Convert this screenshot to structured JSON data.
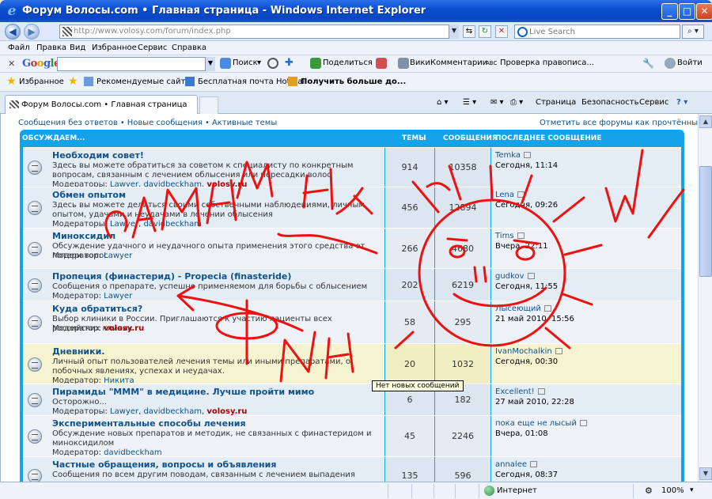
{
  "window": {
    "title": "Форум Волосы.com • Главная страница - Windows Internet Explorer",
    "minimize": "_",
    "maximize": "□",
    "close": "✕"
  },
  "address": {
    "url": "http://www.volosy.com/forum/index.php",
    "search_placeholder": "Live Search"
  },
  "menu": [
    "Файл",
    "Правка",
    "Вид",
    "Избранное",
    "Сервис",
    "Справка"
  ],
  "google_toolbar": {
    "logo": "Google",
    "search_btn": "Поиск",
    "share": "Поделиться",
    "wiki": "ВикиКомментарии",
    "spell": "Проверка правописа...",
    "login": "Войти"
  },
  "favorites": {
    "label": "Избранное",
    "items": [
      "Рекомендуемые сайты",
      "Бесплатная почта Hotmail",
      "Получить больше до..."
    ]
  },
  "tabs": {
    "active": "Форум Волосы.com • Главная страница",
    "commands": [
      "Страница",
      "Безопасность",
      "Сервис"
    ]
  },
  "page": {
    "links": [
      "Сообщения без ответов",
      "Новые сообщения",
      "Активные темы"
    ],
    "link_sep": "•",
    "mark_read": "Отметить все форумы как прочтённые",
    "header": {
      "category": "ОБСУЖДАЕМ...",
      "topics": "ТЕМЫ",
      "posts": "СООБЩЕНИЯ",
      "last": "ПОСЛЕДНЕЕ СООБЩЕНИЕ"
    },
    "forums": [
      {
        "title": "Необходим совет!",
        "desc": "Здесь вы можете обратиться за советом к специалисту по конкретным вопросам, связанным с лечением облысения или пересадки волос",
        "mod_label": "Модераторы:",
        "mods": [
          "Lawyer",
          "davidbeckham"
        ],
        "mods_red": [
          "volosy.ru"
        ],
        "topics": "914",
        "posts": "10358",
        "last_user": "Temka",
        "last_date": "Сегодня, 11:14"
      },
      {
        "title": "Обмен опытом",
        "desc": "Здесь вы можете делиться своими собственными наблюдениями, личным опытом, удачами и неудачами в лечении облысения",
        "mod_label": "Модераторы:",
        "mods": [
          "Lawyer",
          "davidbeckham"
        ],
        "mods_red": [],
        "topics": "456",
        "posts": "12894",
        "last_user": "Lena",
        "last_date": "Сегодня, 09:26"
      },
      {
        "title": "Миноксидил",
        "desc": "Обсуждение удачного и неудачного опыта применения этого средства от потери волос",
        "mod_label": "Модератор:",
        "mods": [
          "Lawyer"
        ],
        "mods_red": [],
        "topics": "266",
        "posts": "4680",
        "last_user": "Tims",
        "last_date": "Вчера, 22:11"
      },
      {
        "title": "Пропеция (финастерид) - Propecia (finasteride)",
        "desc": "Сообщения о препарате, успешно применяемом для борьбы с облысением",
        "mod_label": "Модератор:",
        "mods": [
          "Lawyer"
        ],
        "mods_red": [],
        "topics": "202",
        "posts": "6219",
        "last_user": "gudkov",
        "last_date": "Сегодня, 11:55"
      },
      {
        "title": "Куда обратиться?",
        "desc": "Выбор клиники в России. Приглашаются к участию пациенты всех российских клиник",
        "mod_label": "Модератор:",
        "mods": [],
        "mods_red": [
          "volosy.ru"
        ],
        "topics": "58",
        "posts": "295",
        "last_user": "Лысеющий",
        "last_date": "21 май 2010, 15:56"
      },
      {
        "title": "Дневники.",
        "desc": "Личный опыт пользователей лечения темы или иными препаратами, о побочных явлениях, успехах и неудачах.",
        "mod_label": "Модератор:",
        "mods": [
          "Никита"
        ],
        "mods_red": [],
        "topics": "20",
        "posts": "1032",
        "last_user": "IvanMochalkin",
        "last_date": "Сегодня, 00:30"
      },
      {
        "title": "Пирамиды \"МММ\" в медицине. Лучше пройти мимо",
        "desc": "Осторожно...",
        "mod_label": "Модераторы:",
        "mods": [
          "Lawyer",
          "davidbeckham"
        ],
        "mods_red": [
          "volosy.ru"
        ],
        "topics": "6",
        "posts": "182",
        "last_user": "Excellent!",
        "last_date": "27 май 2010, 22:28"
      },
      {
        "title": "Экспериментальные способы лечения",
        "desc": "Обсуждение новых препаратов и методик, не связанных с финастеридом и миноксидилом",
        "mod_label": "Модератор:",
        "mods": [
          "davidbeckham"
        ],
        "mods_red": [],
        "topics": "45",
        "posts": "2246",
        "last_user": "пока еще не лысый",
        "last_date": "Вчера, 01:08"
      },
      {
        "title": "Частные обращения, вопросы и объявления",
        "desc": "Сообщения по всем другим поводам, связанным с лечением выпадения волос.",
        "mod_label": "",
        "mods": [],
        "mods_red": [],
        "topics": "135",
        "posts": "596",
        "last_user": "annalee",
        "last_date": "Сегодня, 08:37"
      }
    ],
    "tooltip": "Нет новых сообщений"
  },
  "status": {
    "zone": "Интернет",
    "zoom": "100%"
  },
  "colors": {
    "link": "#105289",
    "header": "#12a3eb",
    "scribble": "#ee1111"
  }
}
